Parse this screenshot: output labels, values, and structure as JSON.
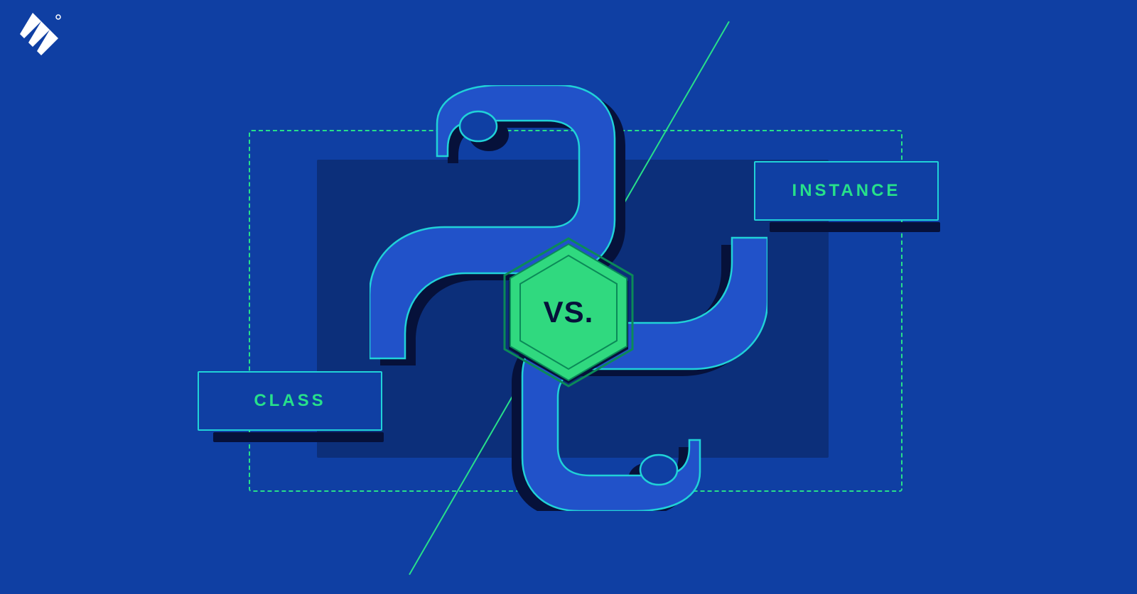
{
  "labels": {
    "left": "CLASS",
    "right": "INSTANCE",
    "center": "VS."
  },
  "colors": {
    "background": "#0f3fa3",
    "accent_green": "#27e08a",
    "accent_cyan": "#20d2d8",
    "dark_panel": "#0c2f7a",
    "shadow": "#06113a",
    "python_blue": "#2152c9"
  },
  "brand": {
    "logo_name": "Toptal"
  }
}
